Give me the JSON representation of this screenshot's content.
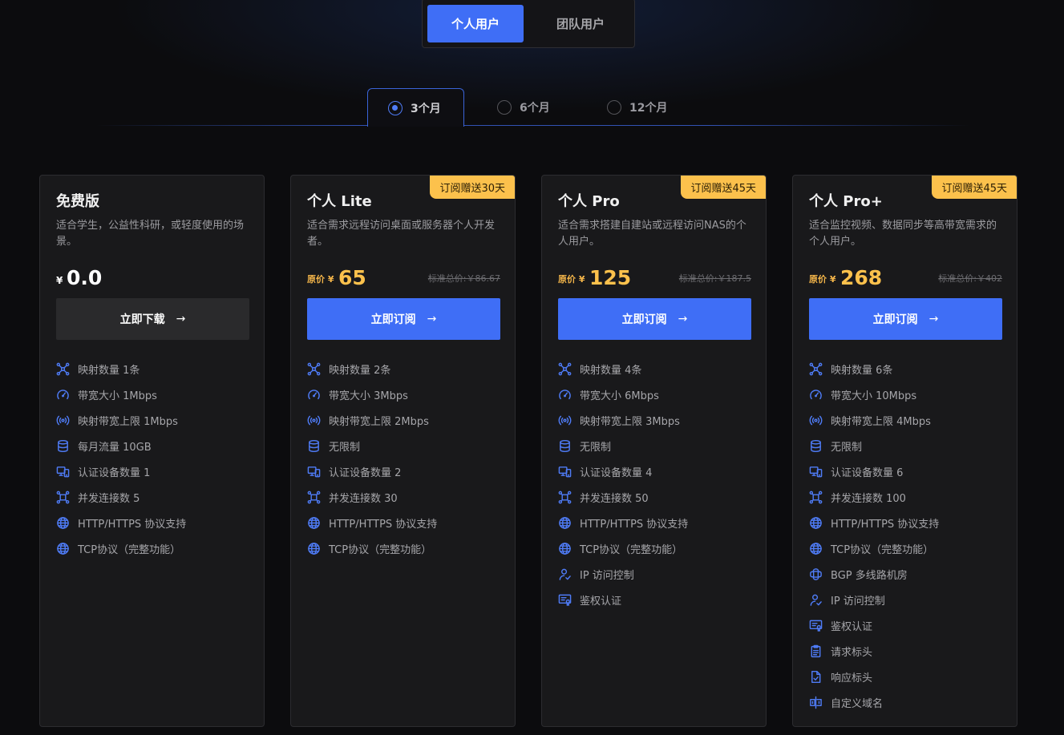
{
  "user_tabs": {
    "personal": "个人用户",
    "team": "团队用户"
  },
  "periods": [
    {
      "label": "3个月",
      "selected": true
    },
    {
      "label": "6个月",
      "selected": false
    },
    {
      "label": "12个月",
      "selected": false
    }
  ],
  "accent_color": "#3f6ef6",
  "badge_color": "#fcc14c",
  "plans": [
    {
      "title": "免费版",
      "desc": "适合学生，公益性科研，或轻度使用的场景。",
      "currency": "¥",
      "price": "0.0",
      "cta": "立即下载",
      "features": [
        {
          "icon": "mapping-icon",
          "text": "映射数量 1条"
        },
        {
          "icon": "speedometer-icon",
          "text": "带宽大小 1Mbps"
        },
        {
          "icon": "broadcast-icon",
          "text": "映射带宽上限 1Mbps"
        },
        {
          "icon": "database-icon",
          "text": "每月流量 10GB"
        },
        {
          "icon": "devices-icon",
          "text": "认证设备数量 1"
        },
        {
          "icon": "connections-icon",
          "text": "并发连接数 5"
        },
        {
          "icon": "globe-icon",
          "text": "HTTP/HTTPS 协议支持"
        },
        {
          "icon": "globe-icon",
          "text": "TCP协议（完整功能）"
        }
      ]
    },
    {
      "title": "个人 Lite",
      "badge": "订阅赠送30天",
      "desc": "适合需求远程访问桌面或服务器个人开发者。",
      "price_label": "原价 ¥",
      "price": "65",
      "orig_price": "标准总价:￥86.67",
      "cta": "立即订阅",
      "features": [
        {
          "icon": "mapping-icon",
          "text": "映射数量 2条"
        },
        {
          "icon": "speedometer-icon",
          "text": "带宽大小 3Mbps"
        },
        {
          "icon": "broadcast-icon",
          "text": "映射带宽上限 2Mbps"
        },
        {
          "icon": "database-icon",
          "text": "无限制"
        },
        {
          "icon": "devices-icon",
          "text": "认证设备数量 2"
        },
        {
          "icon": "connections-icon",
          "text": "并发连接数 30"
        },
        {
          "icon": "globe-icon",
          "text": "HTTP/HTTPS 协议支持"
        },
        {
          "icon": "globe-icon",
          "text": "TCP协议（完整功能）"
        }
      ]
    },
    {
      "title": "个人 Pro",
      "badge": "订阅赠送45天",
      "desc": "适合需求搭建自建站或远程访问NAS的个人用户。",
      "price_label": "原价 ¥",
      "price": "125",
      "orig_price": "标准总价:￥187.5",
      "cta": "立即订阅",
      "features": [
        {
          "icon": "mapping-icon",
          "text": "映射数量 4条"
        },
        {
          "icon": "speedometer-icon",
          "text": "带宽大小 6Mbps"
        },
        {
          "icon": "broadcast-icon",
          "text": "映射带宽上限 3Mbps"
        },
        {
          "icon": "database-icon",
          "text": "无限制"
        },
        {
          "icon": "devices-icon",
          "text": "认证设备数量 4"
        },
        {
          "icon": "connections-icon",
          "text": "并发连接数 50"
        },
        {
          "icon": "globe-icon",
          "text": "HTTP/HTTPS 协议支持"
        },
        {
          "icon": "globe-icon",
          "text": "TCP协议（完整功能）"
        },
        {
          "icon": "user-check-icon",
          "text": "IP 访问控制"
        },
        {
          "icon": "certificate-icon",
          "text": "鉴权认证"
        }
      ]
    },
    {
      "title": "个人 Pro+",
      "badge": "订阅赠送45天",
      "desc": "适合监控视频、数据同步等高带宽需求的个人用户。",
      "price_label": "原价 ¥",
      "price": "268",
      "orig_price": "标准总价:￥402",
      "cta": "立即订阅",
      "features": [
        {
          "icon": "mapping-icon",
          "text": "映射数量 6条"
        },
        {
          "icon": "speedometer-icon",
          "text": "带宽大小 10Mbps"
        },
        {
          "icon": "broadcast-icon",
          "text": "映射带宽上限 4Mbps"
        },
        {
          "icon": "database-icon",
          "text": "无限制"
        },
        {
          "icon": "devices-icon",
          "text": "认证设备数量 6"
        },
        {
          "icon": "connections-icon",
          "text": "并发连接数 100"
        },
        {
          "icon": "globe-icon",
          "text": "HTTP/HTTPS 协议支持"
        },
        {
          "icon": "globe-icon",
          "text": "TCP协议（完整功能）"
        },
        {
          "icon": "network-icon",
          "text": "BGP 多线路机房"
        },
        {
          "icon": "user-check-icon",
          "text": "IP 访问控制"
        },
        {
          "icon": "certificate-icon",
          "text": "鉴权认证"
        },
        {
          "icon": "clipboard-icon",
          "text": "请求标头"
        },
        {
          "icon": "file-check-icon",
          "text": "响应标头"
        },
        {
          "icon": "domain-icon",
          "text": "自定义域名"
        }
      ]
    }
  ]
}
